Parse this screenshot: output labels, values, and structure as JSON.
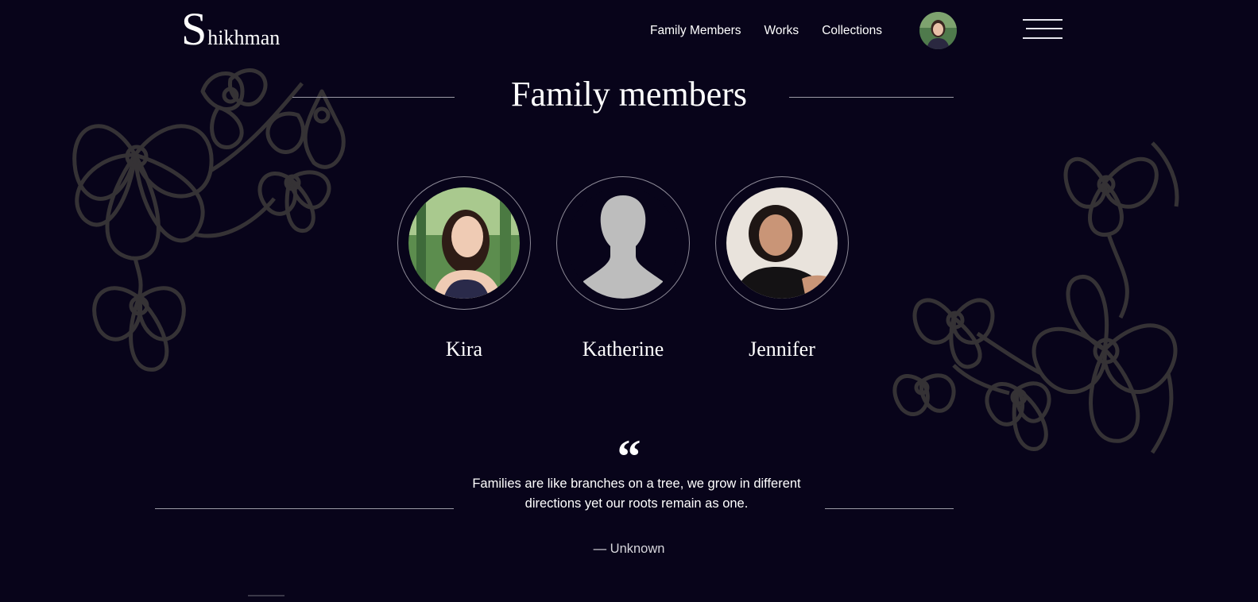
{
  "header": {
    "logo_initial": "S",
    "logo_rest": "hikhman",
    "nav": [
      "Family Members",
      "Works",
      "Collections"
    ]
  },
  "section": {
    "title": "Family members"
  },
  "members": [
    {
      "name": "Kira",
      "photo": "photo"
    },
    {
      "name": "Katherine",
      "photo": "placeholder-silhouette"
    },
    {
      "name": "Jennifer",
      "photo": "photo"
    }
  ],
  "quote": {
    "mark": "“",
    "text": "Families are like branches on a tree, we grow in different directions yet our roots remain as one.",
    "author": "— Unknown"
  },
  "colors": {
    "background": "#08041a",
    "text": "#ffffff",
    "ornament": "#3a3838",
    "line": "#9c9aa6",
    "placeholder": "#bdbdbd"
  }
}
